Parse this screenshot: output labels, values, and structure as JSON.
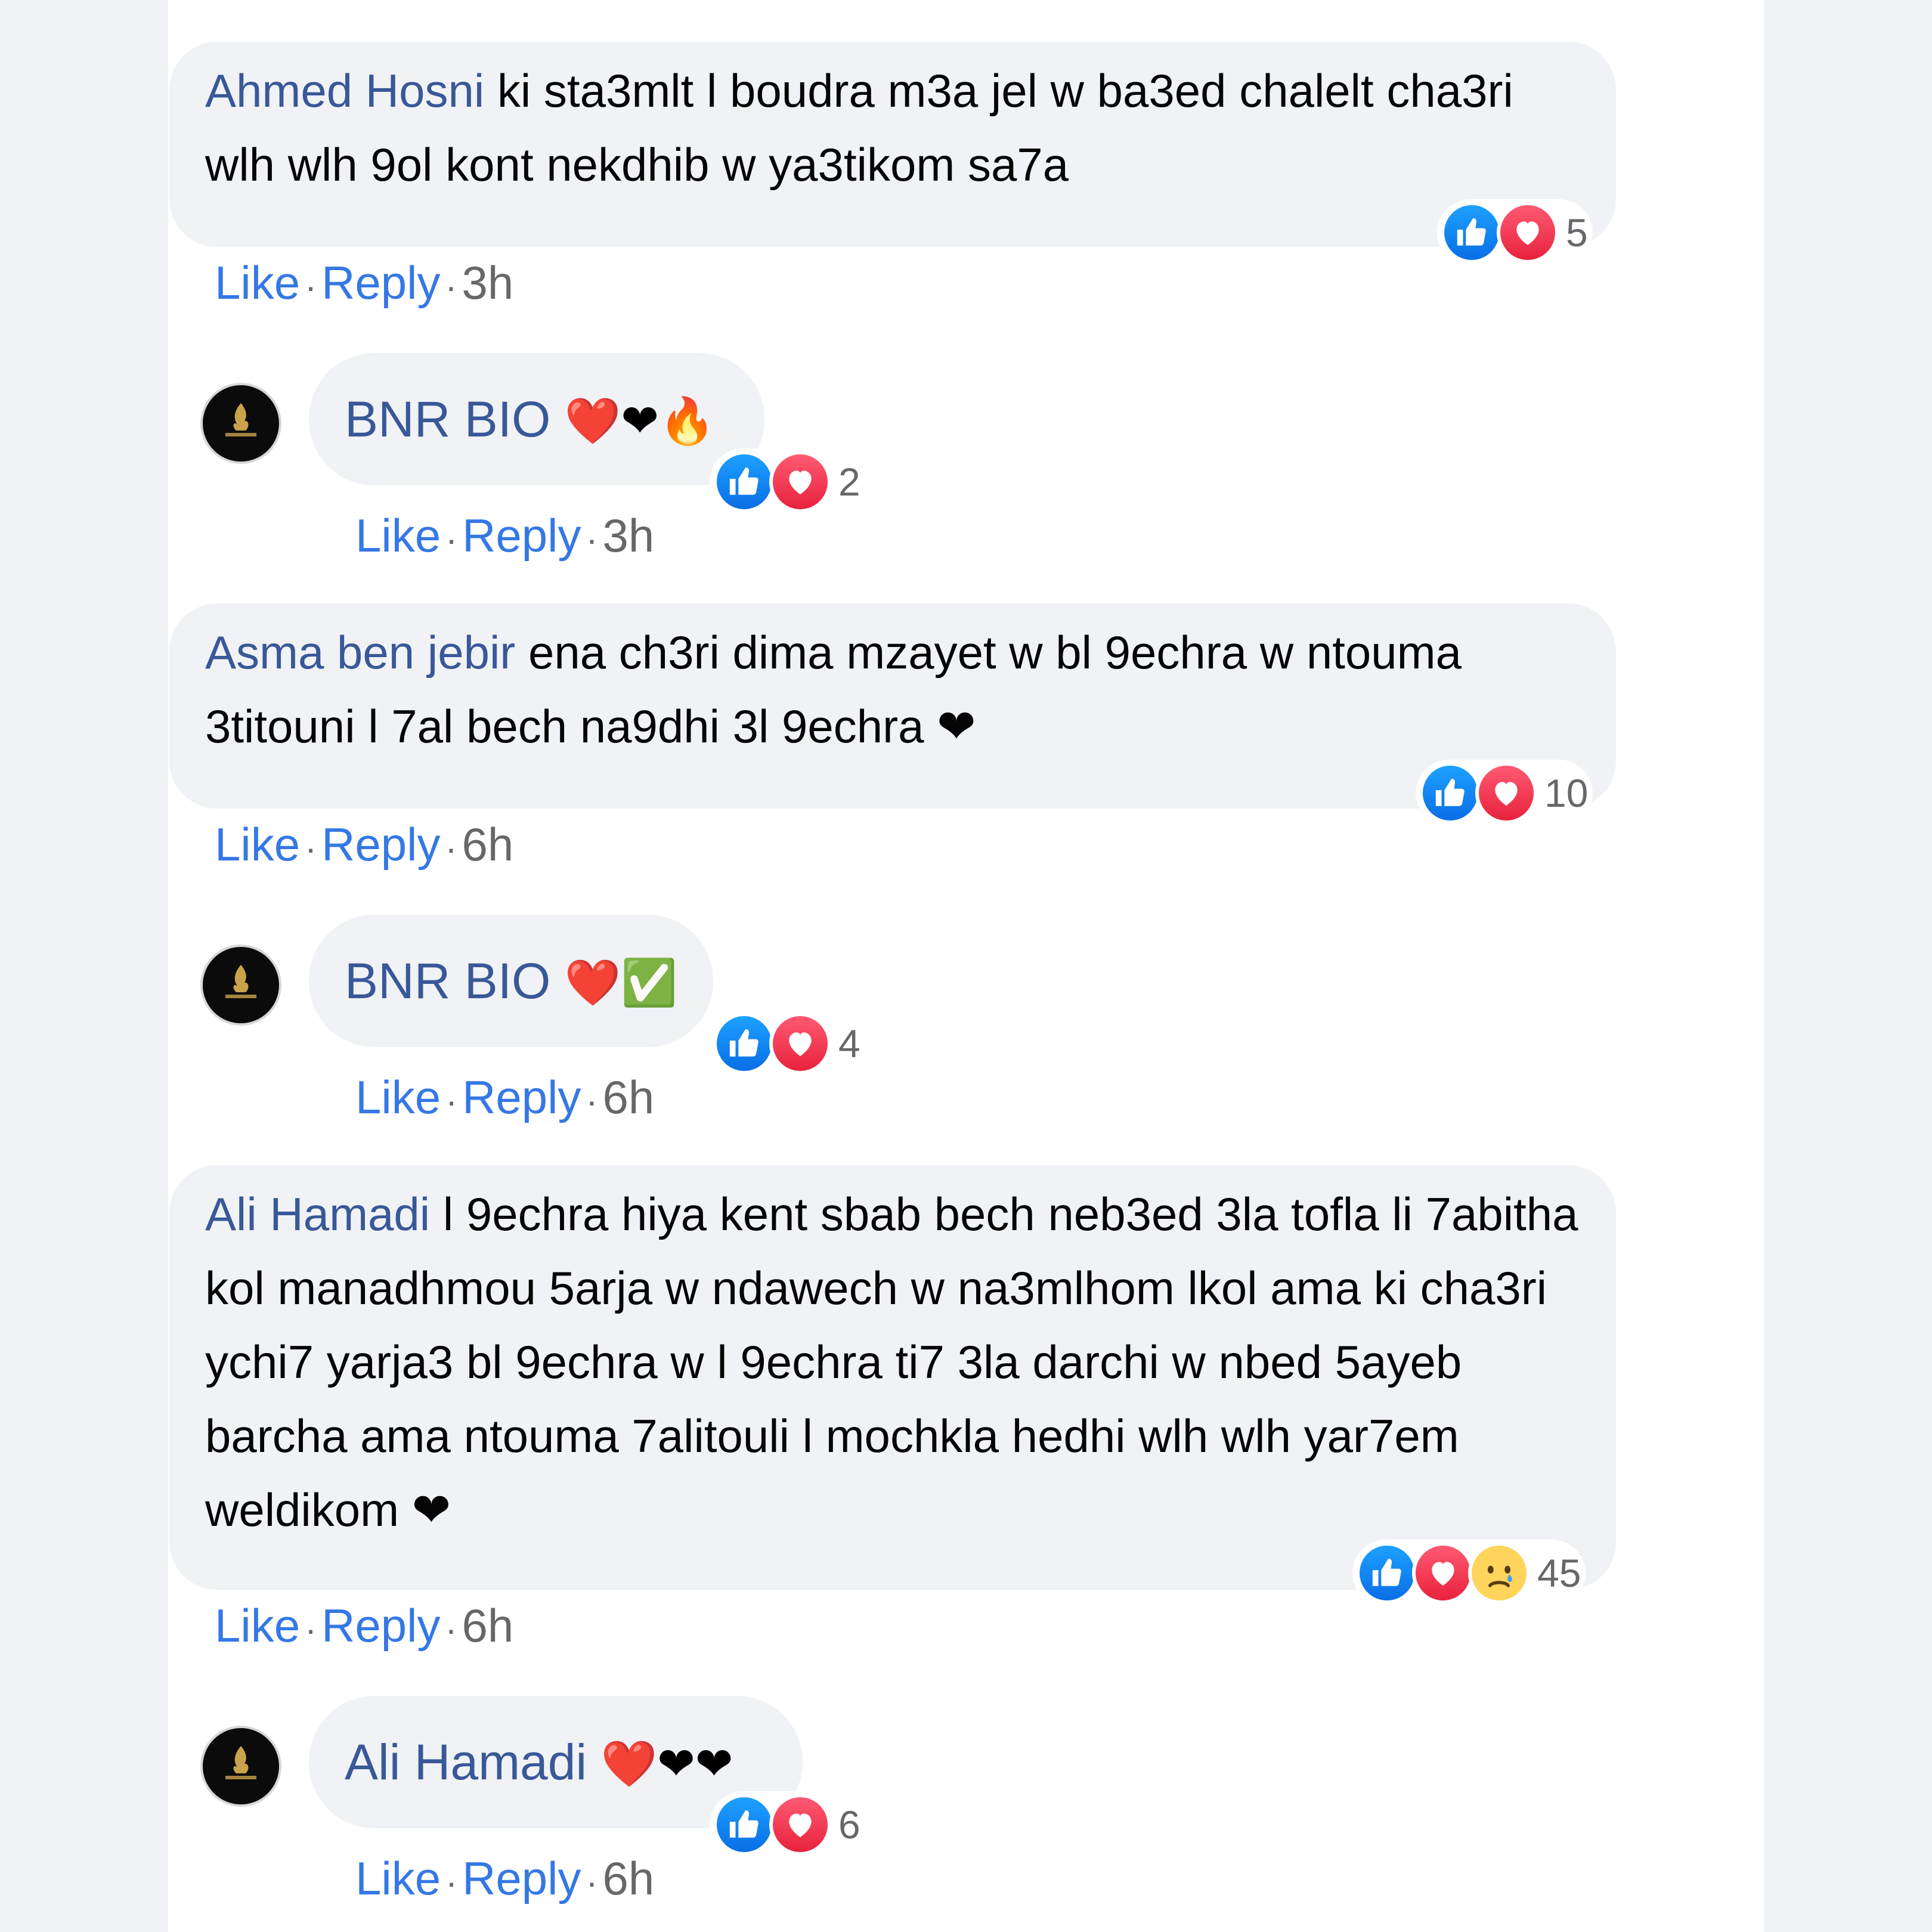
{
  "comments": [
    {
      "author": "Ahmed Hosni",
      "text": "ki sta3mlt l boudra m3a jel w ba3ed chalelt cha3ri wlh wlh 9ol kont nekdhib w ya3tikom sa7a",
      "reactions_count": "5",
      "like_label": "Like",
      "reply_label": "Reply",
      "time": "3h",
      "reply": {
        "author": "BNR BIO",
        "emojis": "❤️❤🔥",
        "reactions_count": "2",
        "like_label": "Like",
        "reply_label": "Reply",
        "time": "3h"
      }
    },
    {
      "author": "Asma ben jebir",
      "text": "ena ch3ri dima mzayet w bl 9echra w ntouma 3titouni l 7al bech na9dhi 3l 9echra ❤",
      "reactions_count": "10",
      "like_label": "Like",
      "reply_label": "Reply",
      "time": "6h",
      "reply": {
        "author": "BNR BIO",
        "emojis": "❤️✅",
        "reactions_count": "4",
        "like_label": "Like",
        "reply_label": "Reply",
        "time": "6h"
      }
    },
    {
      "author": "Ali Hamadi",
      "text": "l 9echra hiya kent sbab bech neb3ed 3la tofla li 7abitha kol manadhmou 5arja w ndawech w na3mlhom lkol ama ki cha3ri ychi7 yarja3 bl 9echra w l 9echra ti7 3la darchi w nbed 5ayeb barcha ama ntouma 7alitouli l mochkla hedhi wlh wlh yar7em weldikom ❤",
      "reactions_count": "45",
      "like_label": "Like",
      "reply_label": "Reply",
      "time": "6h",
      "reply": {
        "author": "Ali Hamadi",
        "emojis": "❤️❤❤",
        "reactions_count": "6",
        "like_label": "Like",
        "reply_label": "Reply",
        "time": "6h"
      }
    }
  ],
  "icons": {
    "like": "thumbs-up-icon",
    "love": "heart-icon",
    "sad": "sad-face-icon",
    "avatar": "bnr-bio-logo"
  },
  "colors": {
    "author": "#385898",
    "link": "#3578e5",
    "like_blue": "#1877f2",
    "love_red": "#f02849",
    "bubble_bg": "#f0f2f5"
  }
}
